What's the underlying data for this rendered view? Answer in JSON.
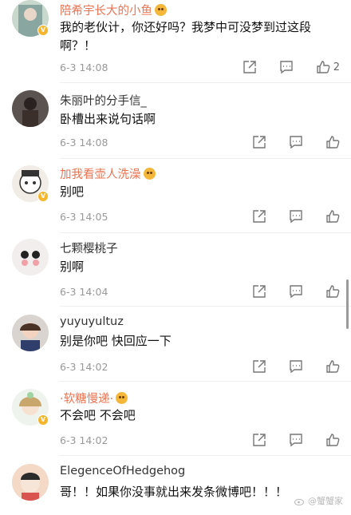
{
  "comments": [
    {
      "user": "陪希宇长大的小鱼",
      "vip": true,
      "emoji": true,
      "text": "我的老伙计，你还好吗？我梦中可没梦到过这段啊？！",
      "time": "6-3 14:08",
      "likes": "2",
      "badge": true
    },
    {
      "user": "朱丽叶的分手信_",
      "vip": false,
      "emoji": false,
      "text": "卧槽出来说句话啊",
      "time": "6-3 14:08",
      "likes": "",
      "badge": false
    },
    {
      "user": "加我看壶人洗澡",
      "vip": true,
      "emoji": true,
      "text": "别吧",
      "time": "6-3 14:05",
      "likes": "",
      "badge": true
    },
    {
      "user": "七颗樱桃子",
      "vip": false,
      "emoji": false,
      "text": "别啊",
      "time": "6-3 14:04",
      "likes": "",
      "badge": false
    },
    {
      "user": "yuyuyultuz",
      "vip": false,
      "emoji": false,
      "text": "别是你吧 快回应一下",
      "time": "6-3 14:02",
      "likes": "",
      "badge": false
    },
    {
      "user": "·软糖慢递·",
      "vip": true,
      "emoji": true,
      "text": "不会吧 不会吧",
      "time": "6-3 14:02",
      "likes": "",
      "badge": true
    },
    {
      "user": "ElegenceOfHedgehog",
      "vip": false,
      "emoji": false,
      "text": "哥！！如果你没事就出来发条微博吧！！！",
      "time": "",
      "likes": "",
      "badge": false
    }
  ],
  "watermark": "@蟹蟹家",
  "icons": {
    "share": "share-icon",
    "reply": "comment-icon",
    "like": "thumbs-up-icon",
    "verified": "verified-badge-icon"
  },
  "colors": {
    "vip_name": "#eb7350",
    "normal_name": "#333333",
    "time": "#999999",
    "badge": "#f7b52c"
  }
}
